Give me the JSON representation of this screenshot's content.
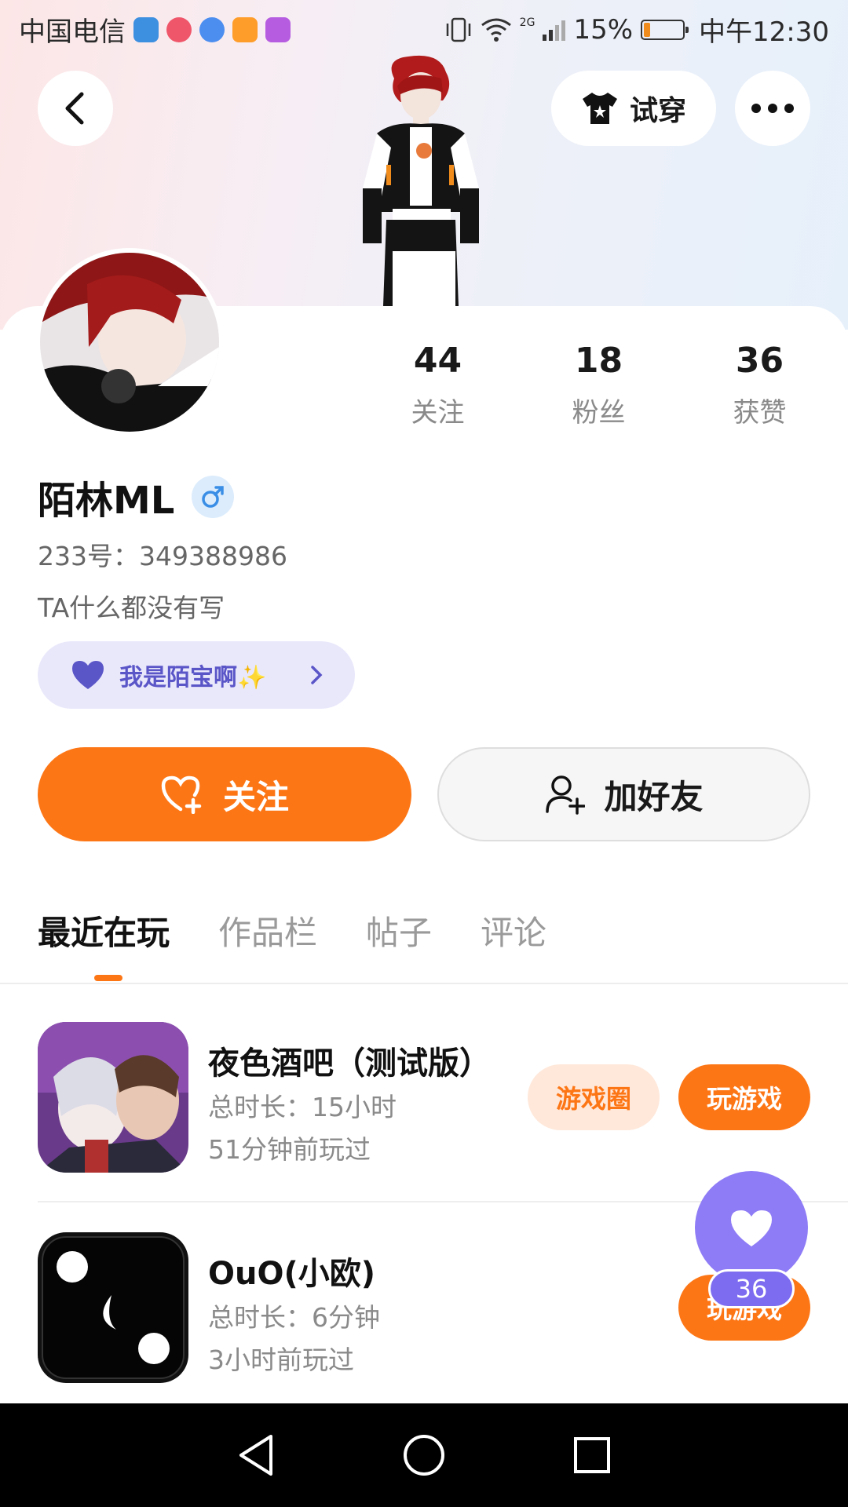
{
  "status_bar": {
    "carrier": "中国电信",
    "network": "2G",
    "battery": "15%",
    "time": "中午12:30"
  },
  "header": {
    "tryon_label": "试穿"
  },
  "stats": [
    {
      "value": "44",
      "label": "关注"
    },
    {
      "value": "18",
      "label": "粉丝"
    },
    {
      "value": "36",
      "label": "获赞"
    }
  ],
  "profile": {
    "name": "陌林ML",
    "uid": "233号：349388986",
    "bio": "TA什么都没有写",
    "tag": "我是陌宝啊✨"
  },
  "actions": {
    "follow_label": "关注",
    "add_friend_label": "加好友"
  },
  "tabs": [
    "最近在玩",
    "作品栏",
    "帖子",
    "评论"
  ],
  "games": [
    {
      "title": "夜色酒吧（测试版）",
      "duration": "总时长：15小时",
      "last_played": "51分钟前玩过",
      "circle_label": "游戏圈",
      "play_label": "玩游戏"
    },
    {
      "title": "OuO(小欧)",
      "duration": "总时长：6分钟",
      "last_played": "3小时前玩过",
      "play_label": "玩游戏"
    }
  ],
  "like_fab": {
    "count": "36"
  },
  "colors": {
    "accent": "#fd7616",
    "purple": "#8e7cf6",
    "tag_bg": "#e9e8fb"
  }
}
